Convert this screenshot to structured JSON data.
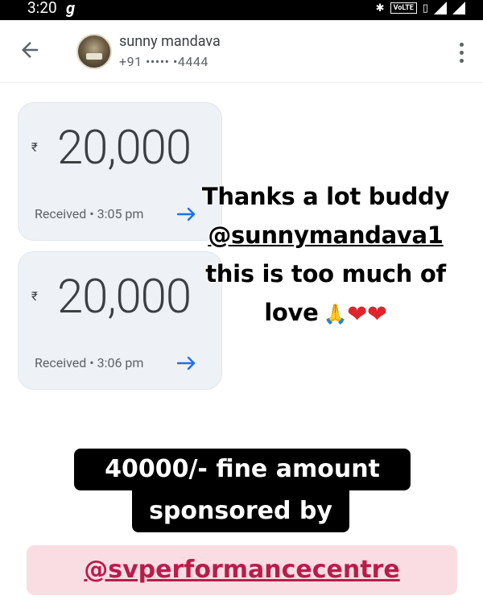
{
  "status_bar": {
    "time": "3:20",
    "carrier_glyph": "g",
    "volte": "VoLTE"
  },
  "header": {
    "contact_name": "sunny mandava",
    "contact_phone": "+91 ••••• •4444",
    "icons": [
      "back-arrow-icon",
      "more-vert-icon"
    ]
  },
  "payments": [
    {
      "currency": "₹",
      "amount": "20,000",
      "status": "Received • 3:05 pm"
    },
    {
      "currency": "₹",
      "amount": "20,000",
      "status": "Received • 3:06 pm"
    }
  ],
  "caption": {
    "line1": "Thanks a lot buddy",
    "mention": "@sunnymandava1",
    "line3": "this is too much of",
    "line4": "love",
    "emoji": [
      "🙏",
      "❤",
      "❤"
    ]
  },
  "stickers": {
    "line1": "40000/- fine amount",
    "line2": "sponsored by",
    "tag": "@svperformancecentre"
  },
  "colors": {
    "accent_blue": "#1a73e8",
    "card_bg": "#eef1f6",
    "tag_bg": "#f9dde3",
    "tag_text": "#b81d4a"
  }
}
